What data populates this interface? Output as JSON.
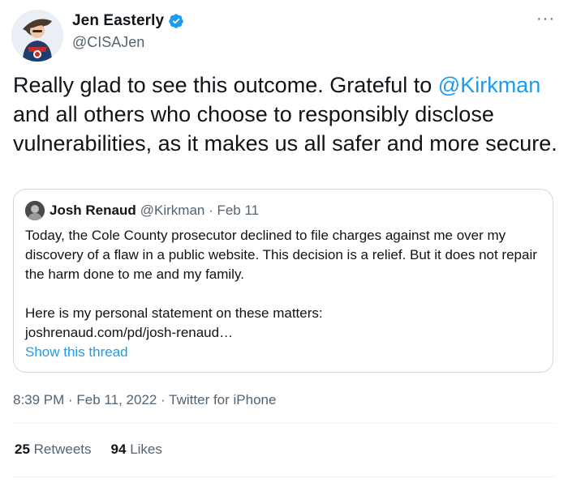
{
  "author": {
    "display_name": "Jen Easterly",
    "handle": "@CISAJen",
    "verified": true
  },
  "more_label": "···",
  "tweet": {
    "text_before": "Really glad to see this outcome. Grateful to ",
    "mention": "@Kirkman",
    "text_after": " and all others who choose to responsibly disclose vulnerabilities, as it makes us all safer and more secure."
  },
  "quoted": {
    "name": "Josh Renaud",
    "meta": "@Kirkman · Feb 11",
    "paragraph1": "Today, the Cole County prosecutor declined to file charges against me over my discovery of a flaw in a public website. This decision is a relief. But it does not repair the harm done to me and my family.",
    "paragraph2": "Here is my personal statement on these matters:",
    "link": "joshrenaud.com/pd/josh-renaud…",
    "show_thread": "Show this thread"
  },
  "meta": {
    "time": "8:39 PM",
    "date": "Feb 11, 2022",
    "source": "Twitter for iPhone",
    "separator": " · "
  },
  "stats": {
    "retweets_count": "25",
    "retweets_label": "Retweets",
    "likes_count": "94",
    "likes_label": "Likes"
  },
  "colors": {
    "accent": "#1d9bf0",
    "text": "#0f1419",
    "secondary": "#536471",
    "border": "#cfd9de"
  },
  "icons": {
    "verified": "verified-badge-icon",
    "more": "more-options-icon"
  }
}
